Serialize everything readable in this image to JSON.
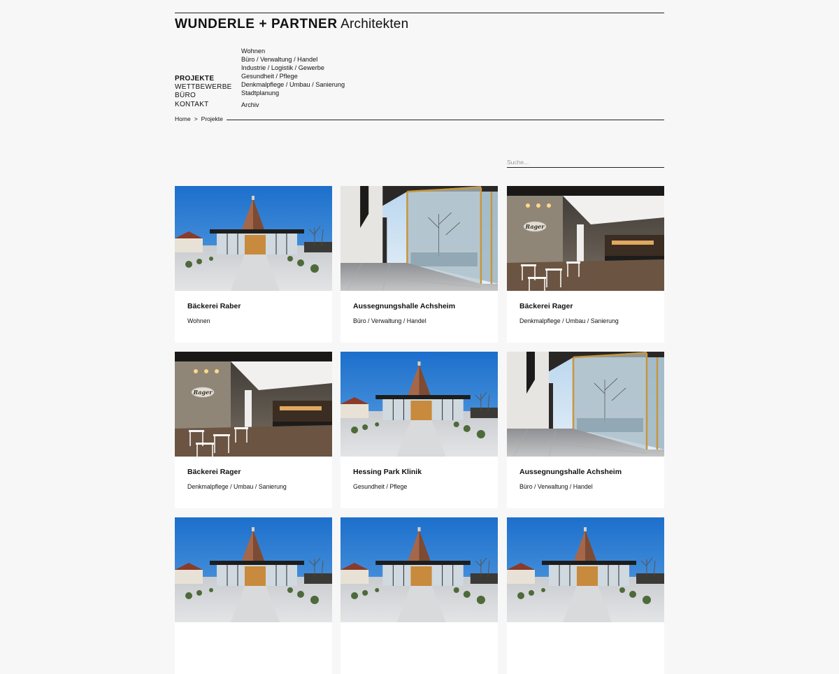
{
  "header": {
    "brand_bold": "WUNDERLE + PARTNER",
    "brand_light": "Architekten"
  },
  "main_nav": [
    {
      "label": "PROJEKTE",
      "active": true
    },
    {
      "label": "WETTBEWERBE",
      "active": false
    },
    {
      "label": "BÜRO",
      "active": false
    },
    {
      "label": "KONTAKT",
      "active": false
    }
  ],
  "sub_nav": [
    "Wohnen",
    "Büro / Verwaltung / Handel",
    "Industrie / Logistik / Gewerbe",
    "Gesundheit / Pflege",
    "Denkmalpflege / Umbau / Sanierung",
    "Stadtplanung"
  ],
  "sub_nav_archive": "Archiv",
  "breadcrumb": {
    "home": "Home",
    "separator": ">",
    "current": "Projekte"
  },
  "search": {
    "placeholder": "Suche..."
  },
  "projects": [
    {
      "title": "Bäckerei Raber",
      "category": "Wohnen",
      "image": "pavilion"
    },
    {
      "title": "Aussegnungshalle Achsheim",
      "category": "Büro / Verwaltung / Handel",
      "image": "glass-hall"
    },
    {
      "title": "Bäckerei Rager",
      "category": "Denkmalpflege / Umbau / Sanierung",
      "image": "cafe-interior"
    },
    {
      "title": "Bäckerei Rager",
      "category": "Denkmalpflege / Umbau / Sanierung",
      "image": "cafe-interior"
    },
    {
      "title": "Hessing Park Klinik",
      "category": "Gesundheit / Pflege",
      "image": "pavilion"
    },
    {
      "title": "Aussegnungshalle Achsheim",
      "category": "Büro / Verwaltung / Handel",
      "image": "glass-hall"
    },
    {
      "title": "",
      "category": "",
      "image": "pavilion"
    },
    {
      "title": "",
      "category": "",
      "image": "pavilion"
    },
    {
      "title": "",
      "category": "",
      "image": "pavilion"
    }
  ],
  "colors": {
    "page_bg": "#f7f7f7",
    "card_bg": "#ffffff",
    "text": "#111111",
    "sky_blue": "#2f7fd0"
  }
}
